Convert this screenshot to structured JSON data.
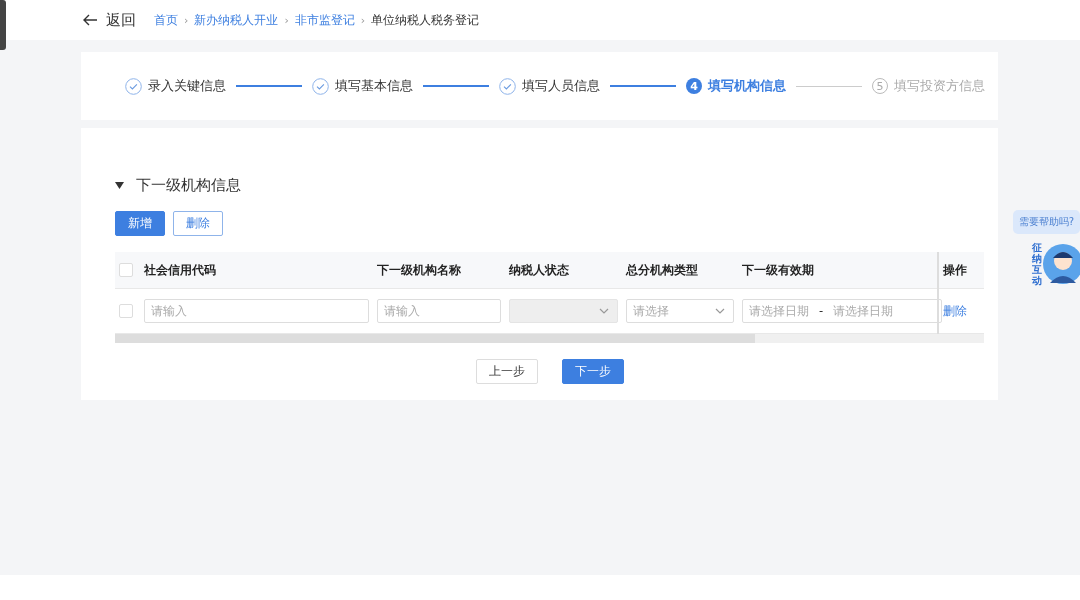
{
  "header": {
    "back": "返回",
    "separator": "›",
    "breadcrumb": [
      {
        "label": "首页",
        "link": true
      },
      {
        "label": "新办纳税人开业",
        "link": true
      },
      {
        "label": "非市监登记",
        "link": true
      },
      {
        "label": "单位纳税人税务登记",
        "link": false
      }
    ]
  },
  "steps": [
    {
      "label": "录入关键信息",
      "completed": true,
      "selected": false
    },
    {
      "label": "填写基本信息",
      "completed": true,
      "selected": false
    },
    {
      "label": "填写人员信息",
      "completed": true,
      "selected": false
    },
    {
      "label": "填写机构信息",
      "completed": false,
      "selected": true,
      "number": "4"
    },
    {
      "label": "填写投资方信息",
      "completed": false,
      "selected": false,
      "number": "5"
    }
  ],
  "section": {
    "title": "下一级机构信息",
    "expanded": true
  },
  "toolbar": [
    {
      "label": "新增",
      "kind": "primary"
    },
    {
      "label": "删除",
      "kind": "plain"
    }
  ],
  "table": {
    "all_checked": false,
    "columns": [
      "社会信用代码",
      "下一级机构名称",
      "纳税人状态",
      "总分机构类型",
      "下一级有效期",
      "操作"
    ],
    "rows": [
      {
        "checked": false,
        "cells": [
          {
            "kind": "input",
            "placeholder": "请输入"
          },
          {
            "kind": "input",
            "placeholder": "请输入"
          },
          {
            "kind": "select",
            "disabled": true
          },
          {
            "kind": "select",
            "placeholder": "请选择",
            "disabled": false
          },
          {
            "kind": "daterange",
            "start": "请选择日期",
            "separator": "-",
            "end": "请选择日期"
          },
          {
            "kind": "link",
            "label": "删除"
          }
        ]
      }
    ]
  },
  "footer_buttons": [
    {
      "label": "上一步",
      "kind": "plain"
    },
    {
      "label": "下一步",
      "kind": "primary"
    }
  ],
  "help": {
    "bubble": "需要帮助吗?",
    "badge": "征纳互动"
  }
}
